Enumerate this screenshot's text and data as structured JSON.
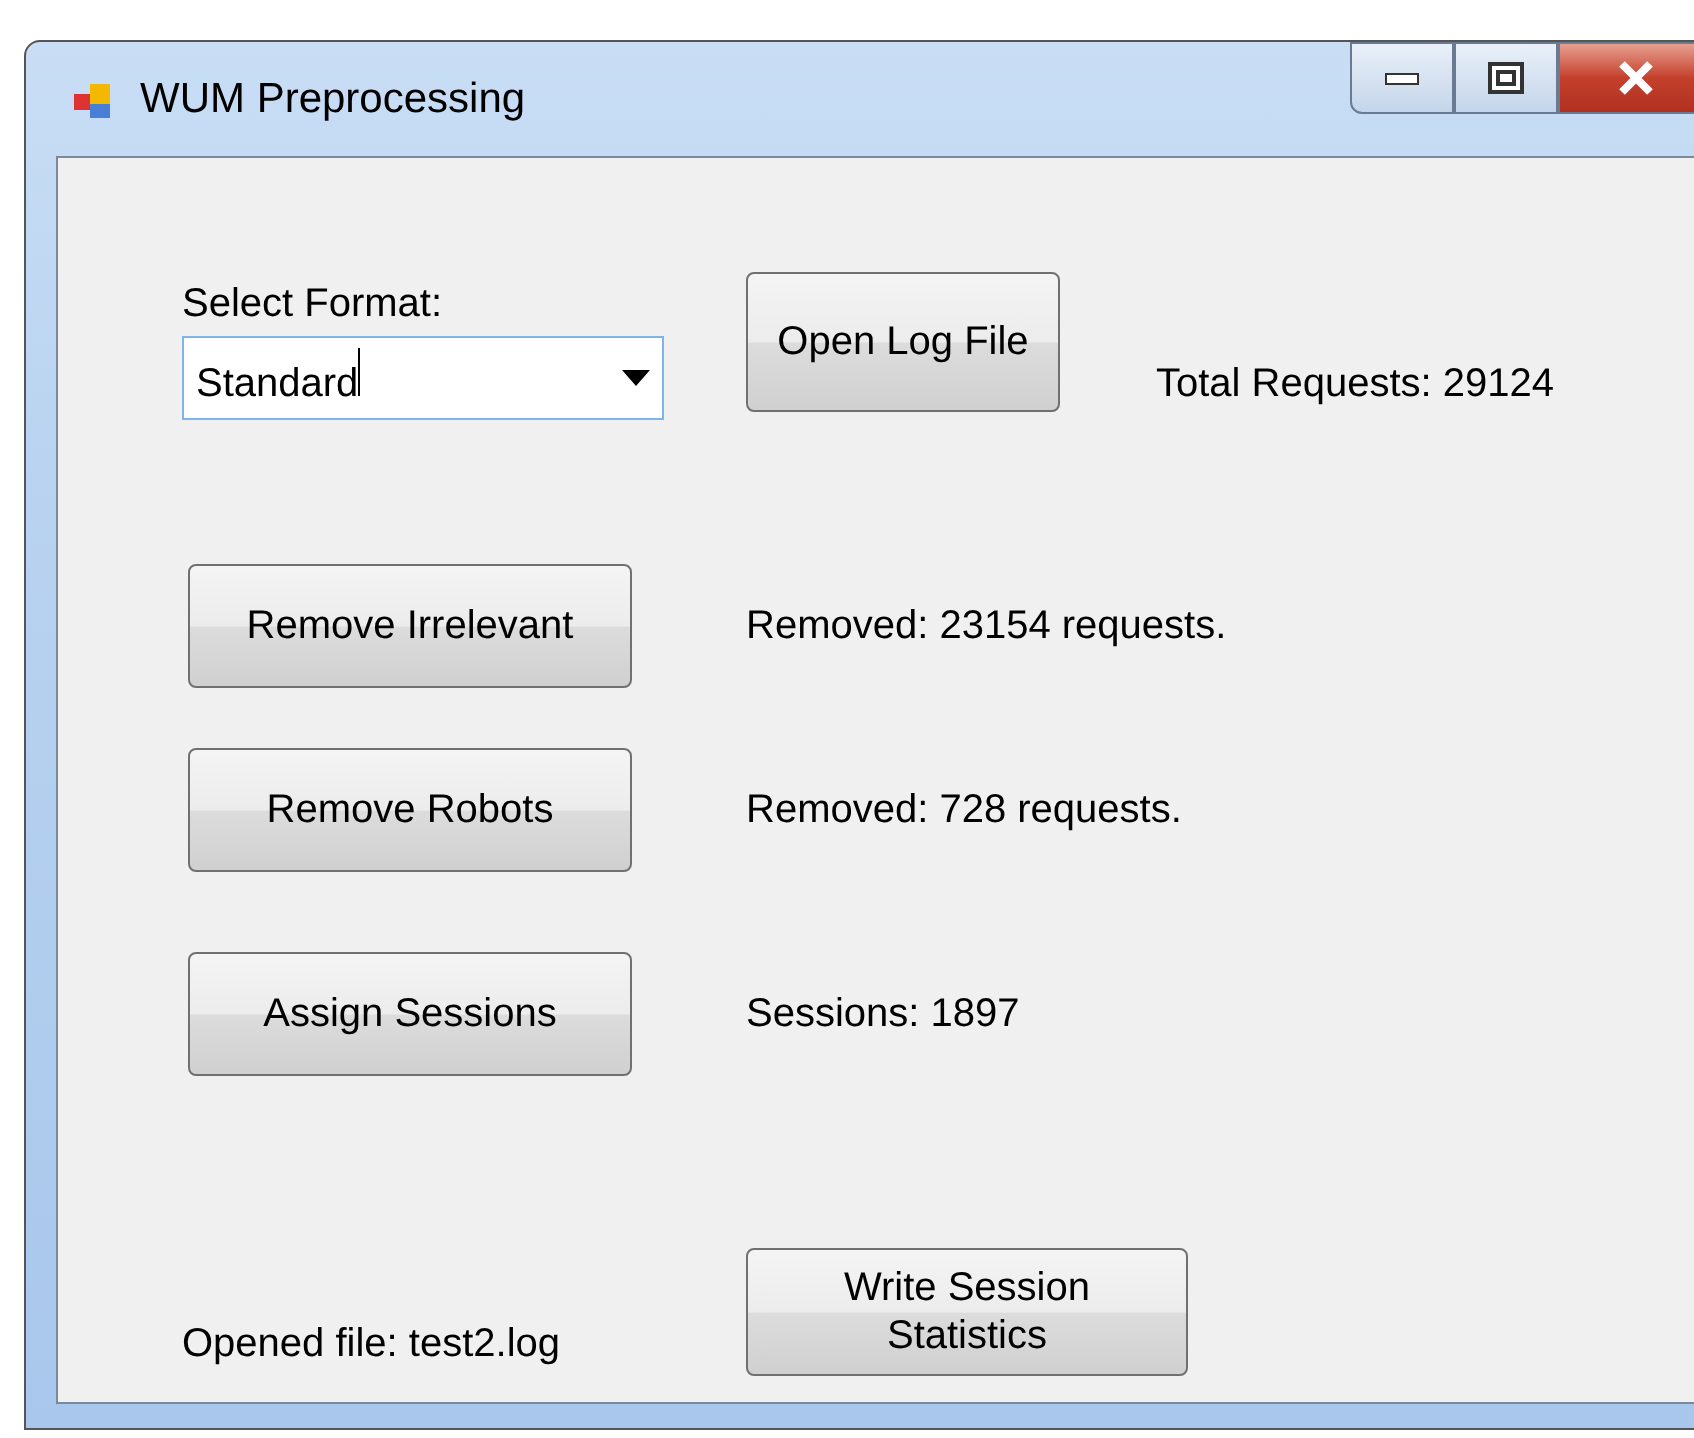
{
  "window": {
    "title": "WUM Preprocessing"
  },
  "format": {
    "label": "Select Format:",
    "value": "Standard"
  },
  "open_button": "Open Log File",
  "total_requests": "Total Requests: 29124",
  "steps": [
    {
      "button": "Remove Irrelevant",
      "result": "Removed: 23154 requests."
    },
    {
      "button": "Remove Robots",
      "result": "Removed: 728 requests."
    },
    {
      "button": "Assign Sessions",
      "result": "Sessions: 1897"
    }
  ],
  "opened_file": "Opened file: test2.log",
  "write_button": "Write Session Statistics"
}
